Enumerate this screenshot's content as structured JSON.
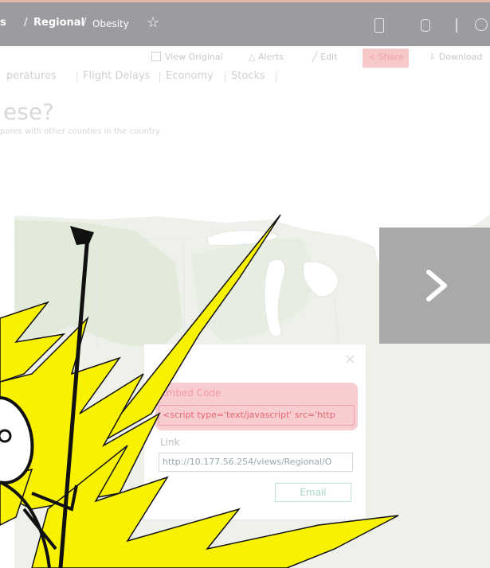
{
  "breadcrumb": {
    "part_a": "s",
    "sep": "/",
    "part_b": "Regional",
    "part_c": "Obesity"
  },
  "topbar": {
    "star_icon": "star-icon",
    "icons": [
      "device-icon",
      "database-icon",
      "divider",
      "search-icon"
    ]
  },
  "toolbar": {
    "view_original": "View Original",
    "alerts": "Alerts",
    "edit": "Edit",
    "share": "Share",
    "download": "Download"
  },
  "tabs": [
    "peratures",
    "Flight Delays",
    "Economy",
    "Stocks"
  ],
  "page": {
    "heading": "ese?",
    "subheading": "pares with other counties in the country"
  },
  "share_dialog": {
    "embed_label": "Embed Code",
    "embed_value": "<script type='text/javascript' src='http",
    "link_label": "Link",
    "link_value": "http://10.177.56.254/views/Regional/O",
    "email_label": "Email",
    "close_icon": "×"
  },
  "next_button": {
    "icon": "chevron-right-icon"
  },
  "colors": {
    "topbar": "#9a9ca0",
    "share_highlight": "#f8cdd0",
    "next_panel": "#a9a9a9",
    "meme_yellow": "#f8f200",
    "email_border": "#bfe3dc"
  }
}
